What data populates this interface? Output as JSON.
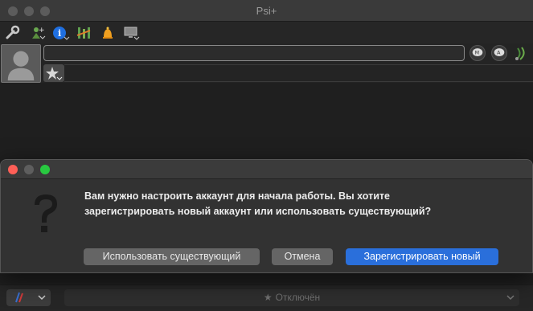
{
  "app": {
    "title": "Psi+"
  },
  "toolbar": {
    "items": [
      {
        "icon": "wrench-icon"
      },
      {
        "icon": "add-contact-icon"
      },
      {
        "icon": "info-icon"
      },
      {
        "icon": "service-discovery-icon"
      },
      {
        "icon": "bell-icon"
      },
      {
        "icon": "monitor-icon"
      }
    ]
  },
  "status": {
    "message": "",
    "placeholder": ""
  },
  "bottom": {
    "account_icon": "psi-icon",
    "status_label": "Отключён"
  },
  "dialog": {
    "message_line1": "Вам нужно настроить аккаунт для начала работы. Вы хотите",
    "message_line2": "зарегистрировать новый аккаунт или использовать существующий?",
    "buttons": {
      "use_existing": "Использовать существующий",
      "cancel": "Отмена",
      "register_new": "Зарегистрировать новый"
    }
  },
  "colors": {
    "accent": "#2a6fdb",
    "close": "#ff5f57",
    "zoom": "#28c940"
  }
}
